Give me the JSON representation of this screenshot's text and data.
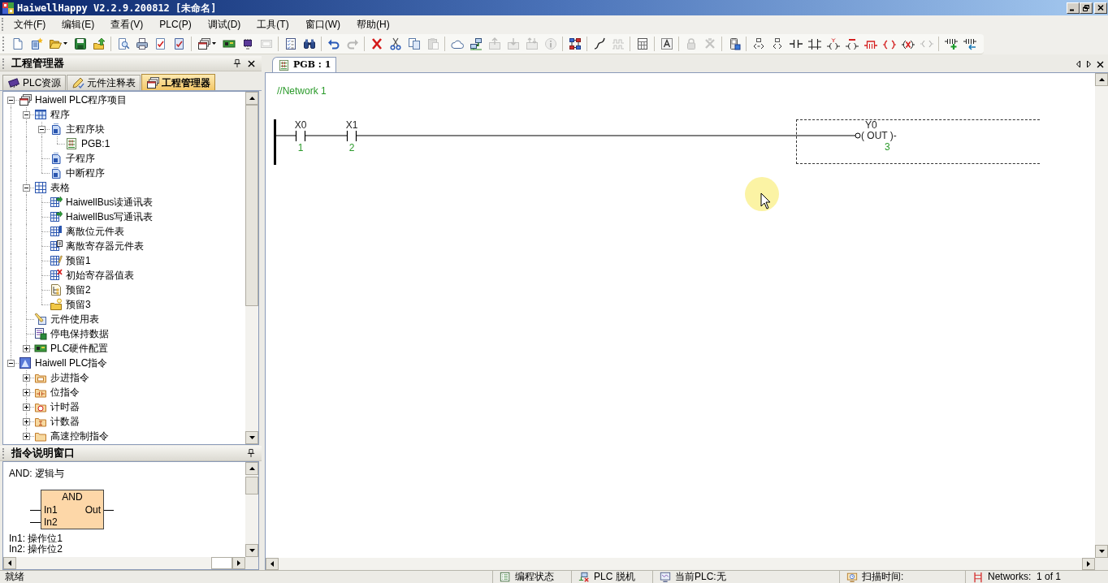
{
  "window": {
    "title": "HaiwellHappy V2.2.9.200812 [未命名]"
  },
  "menu": [
    "文件(F)",
    "编辑(E)",
    "查看(V)",
    "PLC(P)",
    "调试(D)",
    "工具(T)",
    "窗口(W)",
    "帮助(H)"
  ],
  "toolbar": [
    [
      {
        "disabled": false
      },
      {
        "disabled": false
      },
      {
        "disabled": false
      },
      {
        "disabled": false
      },
      {
        "disabled": false
      }
    ],
    [
      {
        "disabled": false
      },
      {
        "disabled": false
      },
      {
        "disabled": false
      },
      {
        "disabled": false
      }
    ],
    [
      {
        "disabled": false
      },
      {
        "disabled": false
      },
      {
        "disabled": false
      },
      {
        "disabled": true
      }
    ],
    [
      {
        "disabled": false
      },
      {
        "disabled": false
      }
    ],
    [
      {
        "disabled": false
      },
      {
        "disabled": true
      }
    ],
    [
      {
        "disabled": false
      },
      {
        "disabled": false
      },
      {
        "disabled": false
      },
      {
        "disabled": true
      }
    ],
    [
      {
        "disabled": false
      },
      {
        "disabled": false
      },
      {
        "disabled": true
      },
      {
        "disabled": true
      },
      {
        "disabled": true
      },
      {
        "disabled": true
      }
    ],
    [
      {
        "disabled": false
      }
    ],
    [
      {
        "disabled": false
      },
      {
        "disabled": true
      }
    ],
    [
      {
        "disabled": false
      }
    ],
    [
      {
        "disabled": false
      }
    ],
    [
      {
        "disabled": true
      },
      {
        "disabled": true
      }
    ],
    [
      {
        "disabled": false
      }
    ],
    [
      {
        "disabled": false
      },
      {
        "disabled": false
      },
      {
        "disabled": false
      },
      {
        "disabled": false
      },
      {
        "disabled": false
      },
      {
        "disabled": false
      },
      {
        "disabled": false
      },
      {
        "disabled": false
      },
      {
        "disabled": false
      },
      {
        "disabled": true
      }
    ],
    [
      {
        "disabled": false
      },
      {
        "disabled": false
      }
    ]
  ],
  "project_panel": {
    "title": "工程管理器",
    "tabs": [
      {
        "label": "PLC资源",
        "selected": false
      },
      {
        "label": "元件注释表",
        "selected": false
      },
      {
        "label": "工程管理器",
        "selected": true
      }
    ],
    "tree": [
      {
        "label": "Haiwell PLC程序项目",
        "kind": "project",
        "expanded": true,
        "children": [
          {
            "label": "程序",
            "kind": "program",
            "expanded": true,
            "children": [
              {
                "label": "主程序块",
                "kind": "block",
                "expanded": true,
                "children": [
                  {
                    "label": "PGB:1",
                    "kind": "ladder"
                  }
                ]
              },
              {
                "label": "子程序",
                "kind": "block"
              },
              {
                "label": "中断程序",
                "kind": "block"
              }
            ]
          },
          {
            "label": "表格",
            "kind": "grid",
            "expanded": true,
            "children": [
              {
                "label": "HaiwellBus读通讯表",
                "kind": "comm"
              },
              {
                "label": "HaiwellBus写通讯表",
                "kind": "comm"
              },
              {
                "label": "离散位元件表",
                "kind": "bits"
              },
              {
                "label": "离散寄存器元件表",
                "kind": "registers"
              },
              {
                "label": "预留1",
                "kind": "reserve"
              },
              {
                "label": "初始寄存器值表",
                "kind": "init"
              },
              {
                "label": "预留2",
                "kind": "outline"
              },
              {
                "label": "预留3",
                "kind": "folder"
              }
            ]
          },
          {
            "label": "元件使用表",
            "kind": "usage"
          },
          {
            "label": "停电保持数据",
            "kind": "retain"
          },
          {
            "label": "PLC硬件配置",
            "kind": "hardware",
            "expanded": false
          }
        ]
      },
      {
        "label": "Haiwell PLC指令",
        "kind": "instructions",
        "expanded": true,
        "children": [
          {
            "label": "步进指令",
            "kind": "step",
            "expanded": false
          },
          {
            "label": "位指令",
            "kind": "bit",
            "expanded": false
          },
          {
            "label": "计时器",
            "kind": "timer",
            "expanded": false
          },
          {
            "label": "计数器",
            "kind": "counter",
            "expanded": false
          },
          {
            "label": "高速控制指令",
            "kind": "highspeed",
            "expanded": false
          }
        ]
      }
    ]
  },
  "instruction_panel": {
    "title": "指令说明窗口",
    "heading": "AND: 逻辑与",
    "block": {
      "name": "AND",
      "inputs": [
        "In1",
        "In2"
      ],
      "output": "Out"
    },
    "operands": [
      "In1: 操作位1",
      "In2: 操作位2"
    ]
  },
  "editor": {
    "tabs": [
      {
        "label": "PGB : 1",
        "selected": true
      }
    ],
    "network": {
      "comment": "//Network 1",
      "elements": [
        {
          "kind": "contact",
          "address": "X0",
          "step": "1",
          "selected": false
        },
        {
          "kind": "contact",
          "address": "X1",
          "step": "2",
          "selected": false
        },
        {
          "kind": "coil",
          "address": "Y0",
          "instruction": "( OUT )-",
          "step": "3",
          "selected": true
        }
      ]
    }
  },
  "status_bar": {
    "message": "就绪",
    "panes": [
      "编程状态",
      "PLC 脱机",
      "当前PLC:无",
      "扫描时间:",
      "Networks:  1 of 1"
    ]
  }
}
